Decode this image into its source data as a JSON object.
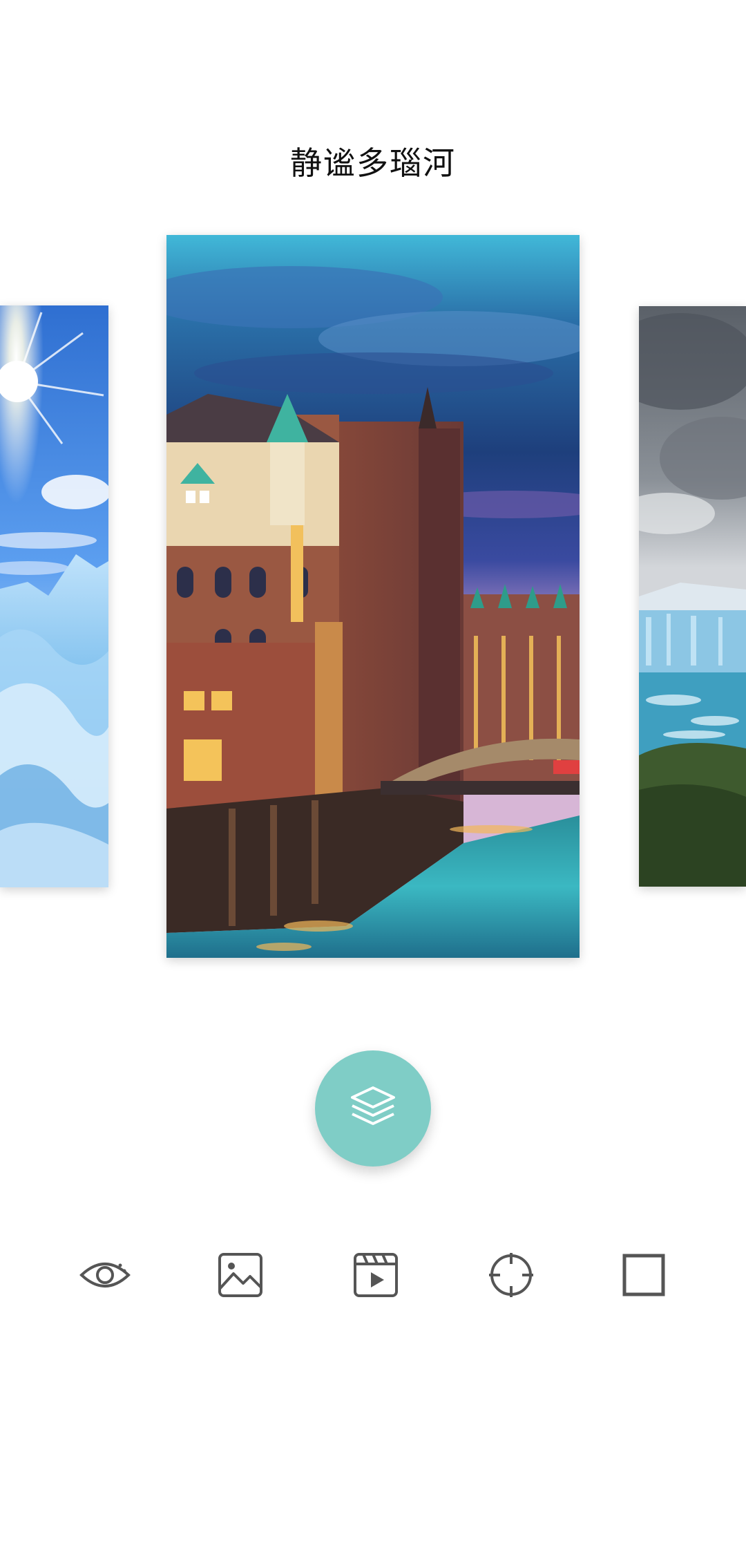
{
  "header": {
    "title": "静谧多瑙河"
  },
  "carousel": {
    "cards": [
      {
        "position": "previous",
        "scene": "glacier-sun"
      },
      {
        "position": "current",
        "scene": "canal-city-dusk"
      },
      {
        "position": "next",
        "scene": "glacier-cloudy"
      }
    ]
  },
  "fab": {
    "icon": "layers-icon",
    "color": "#7fcdc6"
  },
  "toolbar": {
    "items": [
      {
        "name": "preview",
        "icon": "eye-icon"
      },
      {
        "name": "gallery",
        "icon": "image-icon"
      },
      {
        "name": "video",
        "icon": "video-clip-icon"
      },
      {
        "name": "locate",
        "icon": "crosshair-icon"
      },
      {
        "name": "frame",
        "icon": "square-icon"
      }
    ],
    "icon_color": "#555555"
  }
}
